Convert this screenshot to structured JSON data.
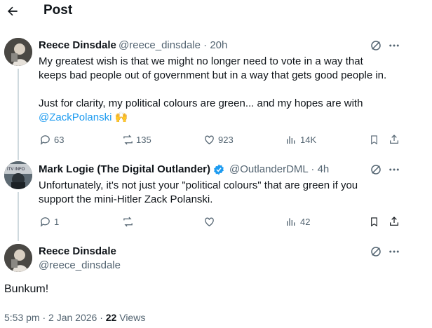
{
  "header": {
    "title": "Post",
    "back_icon": "arrow-left-icon"
  },
  "tweet1": {
    "name": "Reece Dinsdale",
    "handle": "@reece_dinsdale",
    "sep": "·",
    "time": "20h",
    "line1": "My greatest wish is that we might no longer need to vote in a way that",
    "line2": "keeps bad people out of government but in a way that gets good people in.",
    "line3": "Just for clarity, my political colours are green... and my hopes are with",
    "mention": "@ZackPolanski",
    "emoji": "🙌",
    "replies": "63",
    "reposts": "135",
    "likes": "923",
    "views": "14K"
  },
  "tweet2": {
    "name": "Mark Logie (The Digital Outlander)",
    "handle": "@OutlanderDML",
    "sep": "·",
    "time": "4h",
    "line1": "Unfortunately, it's not just your \"political colours\" that are green if you",
    "line2": "support the mini-Hitler Zack Polanski.",
    "replies": "1",
    "views": "42"
  },
  "main": {
    "name": "Reece Dinsdale",
    "handle": "@reece_dinsdale",
    "text": "Bunkum!",
    "time": "5:53 pm · 2 Jan 2026 · ",
    "views_count": "22",
    "views_label": " Views"
  },
  "colors": {
    "accent": "#1d9bf0",
    "muted": "#536471",
    "verified": "#1d9bf0"
  }
}
